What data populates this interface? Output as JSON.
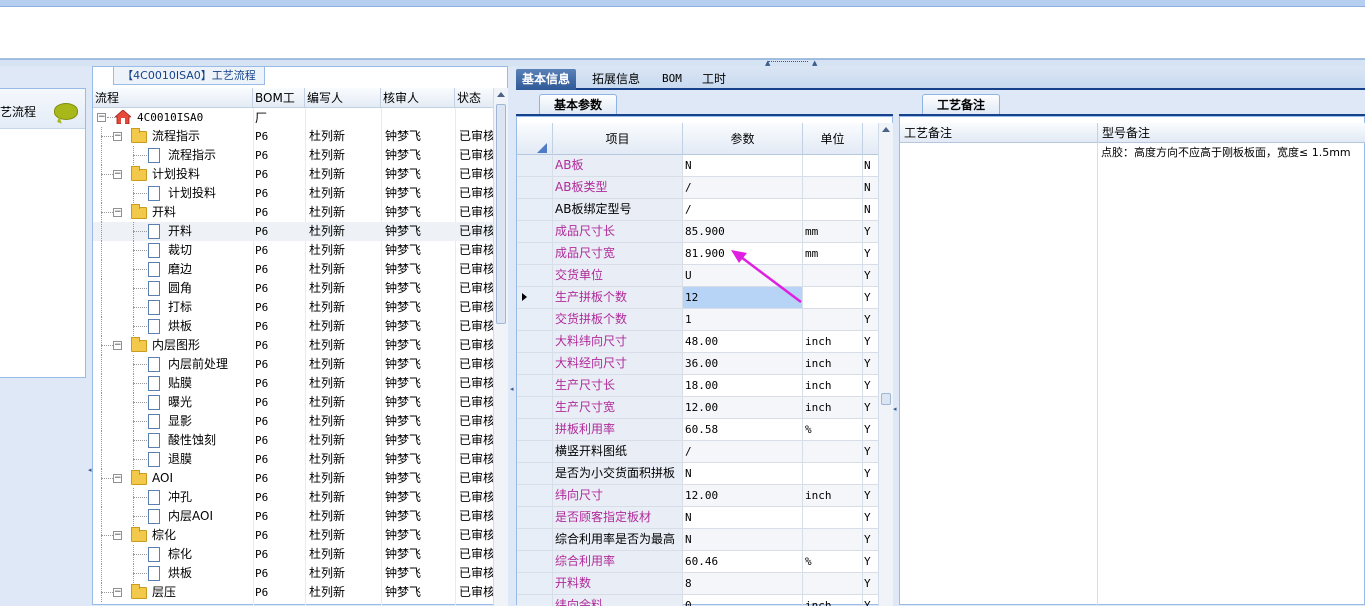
{
  "tree_panel": {
    "title": "【4C0010ISA0】工艺流程",
    "columns": [
      "流程",
      "BOM工厂",
      "编写人",
      "核审人",
      "状态"
    ]
  },
  "left_nav": {
    "label": "艺流程"
  },
  "tree_rows": [
    {
      "level": 0,
      "type": "root",
      "name": "4C0010ISA0",
      "bom": "",
      "writer": "",
      "reviewer": "",
      "status": ""
    },
    {
      "level": 1,
      "type": "folder",
      "name": "流程指示",
      "bom": "P6",
      "writer": "杜列新",
      "reviewer": "钟梦飞",
      "status": "已审核"
    },
    {
      "level": 2,
      "type": "doc",
      "name": "流程指示",
      "bom": "P6",
      "writer": "杜列新",
      "reviewer": "钟梦飞",
      "status": "已审核"
    },
    {
      "level": 1,
      "type": "folder",
      "name": "计划投料",
      "bom": "P6",
      "writer": "杜列新",
      "reviewer": "钟梦飞",
      "status": "已审核"
    },
    {
      "level": 2,
      "type": "doc",
      "name": "计划投料",
      "bom": "P6",
      "writer": "杜列新",
      "reviewer": "钟梦飞",
      "status": "已审核"
    },
    {
      "level": 1,
      "type": "folder",
      "name": "开料",
      "bom": "P6",
      "writer": "杜列新",
      "reviewer": "钟梦飞",
      "status": "已审核"
    },
    {
      "level": 2,
      "type": "doc",
      "name": "开料",
      "bom": "P6",
      "writer": "杜列新",
      "reviewer": "钟梦飞",
      "status": "已审核",
      "selected": true
    },
    {
      "level": 2,
      "type": "doc",
      "name": "裁切",
      "bom": "P6",
      "writer": "杜列新",
      "reviewer": "钟梦飞",
      "status": "已审核"
    },
    {
      "level": 2,
      "type": "doc",
      "name": "磨边",
      "bom": "P6",
      "writer": "杜列新",
      "reviewer": "钟梦飞",
      "status": "已审核"
    },
    {
      "level": 2,
      "type": "doc",
      "name": "圆角",
      "bom": "P6",
      "writer": "杜列新",
      "reviewer": "钟梦飞",
      "status": "已审核"
    },
    {
      "level": 2,
      "type": "doc",
      "name": "打标",
      "bom": "P6",
      "writer": "杜列新",
      "reviewer": "钟梦飞",
      "status": "已审核"
    },
    {
      "level": 2,
      "type": "doc",
      "name": "烘板",
      "bom": "P6",
      "writer": "杜列新",
      "reviewer": "钟梦飞",
      "status": "已审核"
    },
    {
      "level": 1,
      "type": "folder",
      "name": "内层图形",
      "bom": "P6",
      "writer": "杜列新",
      "reviewer": "钟梦飞",
      "status": "已审核"
    },
    {
      "level": 2,
      "type": "doc",
      "name": "内层前处理",
      "bom": "P6",
      "writer": "杜列新",
      "reviewer": "钟梦飞",
      "status": "已审核"
    },
    {
      "level": 2,
      "type": "doc",
      "name": "贴膜",
      "bom": "P6",
      "writer": "杜列新",
      "reviewer": "钟梦飞",
      "status": "已审核"
    },
    {
      "level": 2,
      "type": "doc",
      "name": "曝光",
      "bom": "P6",
      "writer": "杜列新",
      "reviewer": "钟梦飞",
      "status": "已审核"
    },
    {
      "level": 2,
      "type": "doc",
      "name": "显影",
      "bom": "P6",
      "writer": "杜列新",
      "reviewer": "钟梦飞",
      "status": "已审核"
    },
    {
      "level": 2,
      "type": "doc",
      "name": "酸性蚀刻",
      "bom": "P6",
      "writer": "杜列新",
      "reviewer": "钟梦飞",
      "status": "已审核"
    },
    {
      "level": 2,
      "type": "doc",
      "name": "退膜",
      "bom": "P6",
      "writer": "杜列新",
      "reviewer": "钟梦飞",
      "status": "已审核"
    },
    {
      "level": 1,
      "type": "folder",
      "name": "AOI",
      "bom": "P6",
      "writer": "杜列新",
      "reviewer": "钟梦飞",
      "status": "已审核"
    },
    {
      "level": 2,
      "type": "doc",
      "name": "冲孔",
      "bom": "P6",
      "writer": "杜列新",
      "reviewer": "钟梦飞",
      "status": "已审核"
    },
    {
      "level": 2,
      "type": "doc",
      "name": "内层AOI",
      "bom": "P6",
      "writer": "杜列新",
      "reviewer": "钟梦飞",
      "status": "已审核"
    },
    {
      "level": 1,
      "type": "folder",
      "name": "棕化",
      "bom": "P6",
      "writer": "杜列新",
      "reviewer": "钟梦飞",
      "status": "已审核"
    },
    {
      "level": 2,
      "type": "doc",
      "name": "棕化",
      "bom": "P6",
      "writer": "杜列新",
      "reviewer": "钟梦飞",
      "status": "已审核"
    },
    {
      "level": 2,
      "type": "doc",
      "name": "烘板",
      "bom": "P6",
      "writer": "杜列新",
      "reviewer": "钟梦飞",
      "status": "已审核"
    },
    {
      "level": 1,
      "type": "folder",
      "name": "层压",
      "bom": "P6",
      "writer": "杜列新",
      "reviewer": "钟梦飞",
      "status": "已审核"
    }
  ],
  "tabs": [
    "基本信息",
    "拓展信息",
    "BOM",
    "工时"
  ],
  "active_tab": "基本信息",
  "sub_tabs": {
    "basic": "基本参数",
    "notes": "工艺备注"
  },
  "grid": {
    "columns": [
      "项目",
      "参数",
      "单位"
    ],
    "rows": [
      {
        "item": "AB板",
        "param": "N",
        "unit": "",
        "flag": "N",
        "pink": true
      },
      {
        "item": "AB板类型",
        "param": "/",
        "unit": "",
        "flag": "N",
        "pink": true
      },
      {
        "item": "AB板绑定型号",
        "param": "/",
        "unit": "",
        "flag": "N",
        "pink": false
      },
      {
        "item": "成品尺寸长",
        "param": "85.900",
        "unit": "mm",
        "flag": "Y",
        "pink": true
      },
      {
        "item": "成品尺寸宽",
        "param": "81.900",
        "unit": "mm",
        "flag": "Y",
        "pink": true
      },
      {
        "item": "交货单位",
        "param": "U",
        "unit": "",
        "flag": "Y",
        "pink": true
      },
      {
        "item": "生产拼板个数",
        "param": "12",
        "unit": "",
        "flag": "Y",
        "pink": true,
        "selected": true
      },
      {
        "item": "交货拼板个数",
        "param": "1",
        "unit": "",
        "flag": "Y",
        "pink": true
      },
      {
        "item": "大料纬向尺寸",
        "param": "48.00",
        "unit": "inch",
        "flag": "Y",
        "pink": true
      },
      {
        "item": "大料经向尺寸",
        "param": "36.00",
        "unit": "inch",
        "flag": "Y",
        "pink": true
      },
      {
        "item": "生产尺寸长",
        "param": "18.00",
        "unit": "inch",
        "flag": "Y",
        "pink": true
      },
      {
        "item": "生产尺寸宽",
        "param": "12.00",
        "unit": "inch",
        "flag": "Y",
        "pink": true
      },
      {
        "item": "拼板利用率",
        "param": "60.58",
        "unit": "%",
        "flag": "Y",
        "pink": true
      },
      {
        "item": "横竖开料图纸",
        "param": "/",
        "unit": "",
        "flag": "Y",
        "pink": false
      },
      {
        "item": "是否为小交货面积拼板",
        "param": "N",
        "unit": "",
        "flag": "Y",
        "pink": false
      },
      {
        "item": "纬向尺寸",
        "param": "12.00",
        "unit": "inch",
        "flag": "Y",
        "pink": true
      },
      {
        "item": "是否顾客指定板材",
        "param": "N",
        "unit": "",
        "flag": "Y",
        "pink": true
      },
      {
        "item": "综合利用率是否为最高",
        "param": "N",
        "unit": "",
        "flag": "Y",
        "pink": false
      },
      {
        "item": "综合利用率",
        "param": "60.46",
        "unit": "%",
        "flag": "Y",
        "pink": true
      },
      {
        "item": "开料数",
        "param": "8",
        "unit": "",
        "flag": "Y",
        "pink": true
      },
      {
        "item": "纬向余料",
        "param": "0",
        "unit": "inch",
        "flag": "Y",
        "pink": true
      }
    ]
  },
  "notes": {
    "columns": [
      "工艺备注",
      "型号备注"
    ],
    "process_note": "",
    "model_note": "点胶：高度方向不应高于刚板板面，宽度≤ 1.5mm"
  },
  "colors": {
    "pink_text": "#b02a9a",
    "annotation_arrow": "#e020e0",
    "header_blue": "#15428b"
  }
}
